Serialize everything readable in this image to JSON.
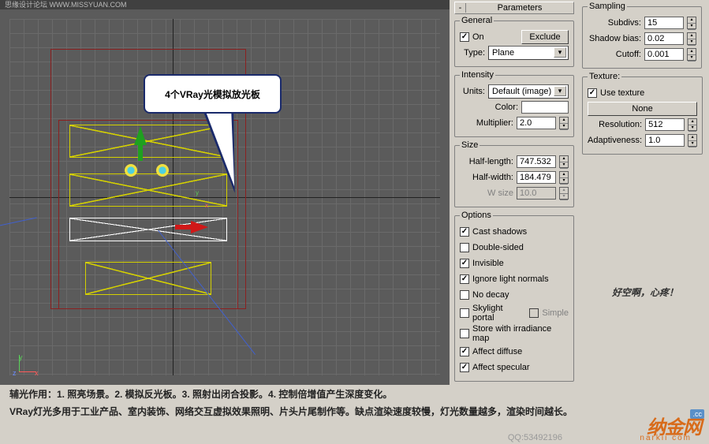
{
  "topbar": "思缘设计论坛  WWW.MISSYUAN.COM",
  "callout": "4个VRay光模拟放光板",
  "rollout": {
    "title": "Parameters",
    "minus": "-"
  },
  "general": {
    "legend": "General",
    "on": "On",
    "exclude": "Exclude",
    "type_lbl": "Type:",
    "type_val": "Plane"
  },
  "intensity": {
    "legend": "Intensity",
    "units_lbl": "Units:",
    "units_val": "Default (image)",
    "color_lbl": "Color:",
    "mult_lbl": "Multiplier:",
    "mult_val": "2.0"
  },
  "size": {
    "legend": "Size",
    "hl_lbl": "Half-length:",
    "hl_val": "747.532",
    "hw_lbl": "Half-width:",
    "hw_val": "184.479",
    "ws_lbl": "W size",
    "ws_val": "10.0"
  },
  "options": {
    "legend": "Options",
    "cast": "Cast shadows",
    "double": "Double-sided",
    "invisible": "Invisible",
    "ignore": "Ignore light normals",
    "nodecay": "No decay",
    "skylight": "Skylight portal",
    "simple": "Simple",
    "store": "Store with irradiance map",
    "diffuse": "Affect diffuse",
    "specular": "Affect specular"
  },
  "sampling": {
    "legend": "Sampling",
    "subdivs_lbl": "Subdivs:",
    "subdivs_val": "15",
    "bias_lbl": "Shadow bias:",
    "bias_val": "0.02",
    "cutoff_lbl": "Cutoff:",
    "cutoff_val": "0.001"
  },
  "texture": {
    "legend": "Texture:",
    "use": "Use texture",
    "none": "None",
    "res_lbl": "Resolution:",
    "res_val": "512",
    "adapt_lbl": "Adaptiveness:",
    "adapt_val": "1.0"
  },
  "vp_axis": {
    "x": "x",
    "y": "y",
    "z": "z"
  },
  "caption_l1": "辅光作用：1. 照亮场景。2. 模拟反光板。3. 照射出闭合投影。4. 控制倍增值产生深度变化。",
  "caption_l2": "VRay灯光多用于工业产品、室内装饰、网络交互虚拟效果照明、片头片尾制作等。缺点渲染速度较慢，灯光数量越多，渲染时间越长。",
  "side_text": "好空啊，心疼！",
  "qq": "QQ:53492196",
  "logo": "纳金网",
  "logo_sub": "narkii com",
  "logo_cc": ".cc"
}
